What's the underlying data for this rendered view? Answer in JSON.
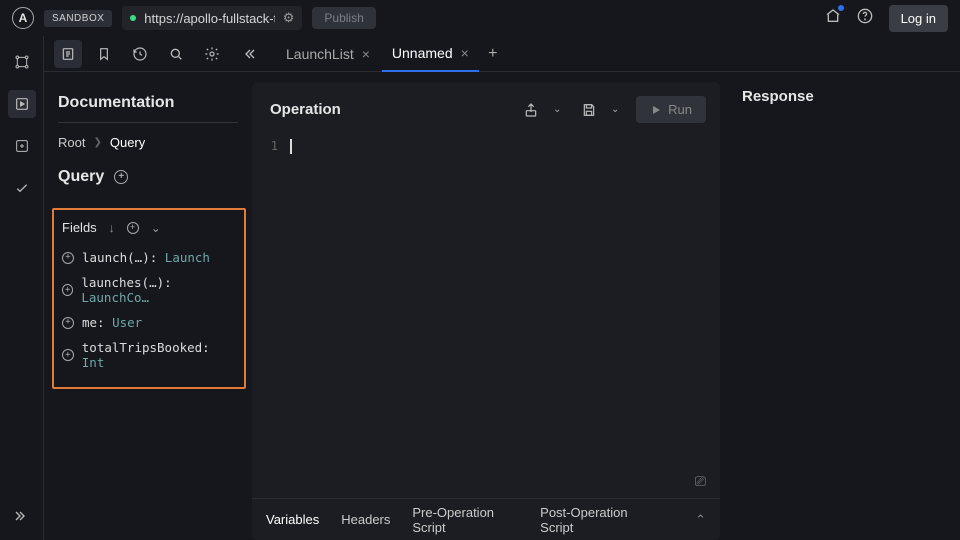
{
  "header": {
    "sandbox_label": "SANDBOX",
    "url": "https://apollo-fullstack-t",
    "publish_label": "Publish",
    "login_label": "Log in"
  },
  "tabs": {
    "items": [
      {
        "label": "LaunchList"
      },
      {
        "label": "Unnamed"
      }
    ]
  },
  "doc": {
    "title": "Documentation",
    "breadcrumb_root": "Root",
    "breadcrumb_current": "Query",
    "query_label": "Query",
    "fields_label": "Fields",
    "fields": [
      {
        "name": "launch(…): ",
        "type": "Launch"
      },
      {
        "name": "launches(…): ",
        "type": "LaunchCo…"
      },
      {
        "name": "me: ",
        "type": "User"
      },
      {
        "name": "totalTripsBooked: ",
        "type": "Int"
      }
    ]
  },
  "operation": {
    "title": "Operation",
    "run_label": "Run",
    "line_number": "1",
    "bottom_tabs": {
      "variables": "Variables",
      "headers": "Headers",
      "preop": "Pre-Operation Script",
      "postop": "Post-Operation Script"
    }
  },
  "response": {
    "title": "Response"
  }
}
